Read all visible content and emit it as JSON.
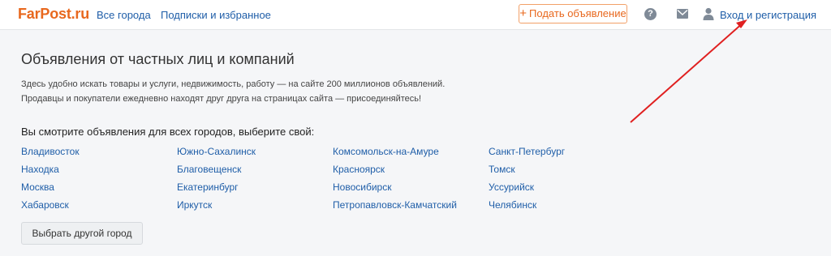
{
  "header": {
    "logo": "FarPost.ru",
    "nav": [
      "Все города",
      "Подписки и избранное"
    ],
    "post_button": "Подать объявление",
    "help_icon": "?",
    "login": "Вход и регистрация",
    "icons": [
      "help-icon",
      "mail-icon",
      "user-icon"
    ]
  },
  "main": {
    "title": "Объявления от частных лиц и компаний",
    "intro_line1": "Здесь удобно искать товары и услуги, недвижимость, работу — на сайте 200 миллионов объявлений.",
    "intro_line2": "Продавцы и покупатели ежедневно находят друг друга на страницах сайта — присоединяйтесь!",
    "choose_city": "Вы смотрите объявления для всех городов, выберите свой:",
    "cities": [
      [
        "Владивосток",
        "Находка",
        "Москва",
        "Хабаровск"
      ],
      [
        "Южно-Сахалинск",
        "Благовещенск",
        "Екатеринбург",
        "Иркутск"
      ],
      [
        "Комсомольск-на-Амуре",
        "Красноярск",
        "Новосибирск",
        "Петропавловск-Камчатский"
      ],
      [
        "Санкт-Петербург",
        "Томск",
        "Уссурийск",
        "Челябинск"
      ]
    ],
    "other_city_button": "Выбрать другой город"
  },
  "colors": {
    "brand": "#e8681e",
    "link": "#1f5ea8",
    "annotation_arrow": "#e02020"
  }
}
